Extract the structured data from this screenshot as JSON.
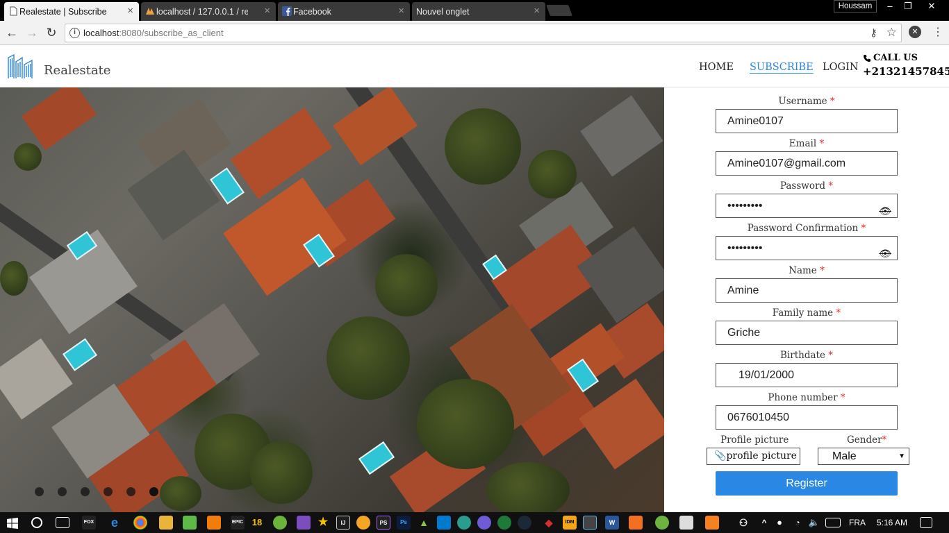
{
  "browser": {
    "tabs": [
      {
        "title": "Realestate | Subscribe",
        "active": true
      },
      {
        "title": "localhost / 127.0.0.1 / rea",
        "active": false
      },
      {
        "title": "Facebook",
        "active": false
      },
      {
        "title": "Nouvel onglet",
        "active": false
      }
    ],
    "profile_name": "Houssam",
    "url_host": "localhost",
    "url_rest": ":8080/subscribe_as_client",
    "close_glyph": "×",
    "window_buttons": [
      "–",
      "❐",
      "✕"
    ]
  },
  "header": {
    "brand": "Realestate",
    "nav": [
      {
        "label": "HOME",
        "active": false
      },
      {
        "label": "SUBSCRIBE",
        "active": true
      },
      {
        "label": "LOGIN",
        "active": false
      }
    ],
    "call_label": "CALL US",
    "call_number": "+21321457845"
  },
  "form": {
    "required_mark": "*",
    "fields": [
      {
        "label": "Username",
        "value": "Amine0107"
      },
      {
        "label": "Email",
        "value": "Amine0107@gmail.com"
      },
      {
        "label": "Password",
        "value": "•••••••••"
      },
      {
        "label": "Password Confirmation",
        "value": "•••••••••"
      },
      {
        "label": "Name",
        "value": "Amine"
      },
      {
        "label": "Family name",
        "value": "Griche"
      },
      {
        "label": "Birthdate",
        "value": "19/01/2000"
      },
      {
        "label": "Phone number",
        "value": "0676010450"
      }
    ],
    "profile_picture_label": "Profile picture",
    "profile_picture_button": "profile picture",
    "gender_label": "Gender",
    "gender_value": "Male",
    "register_label": "Register"
  },
  "carousel": {
    "slide_count": 6
  },
  "taskbar": {
    "language": "FRA",
    "time": "5:16 AM"
  },
  "colors": {
    "accent": "#2b87e4",
    "required": "#e03030"
  }
}
